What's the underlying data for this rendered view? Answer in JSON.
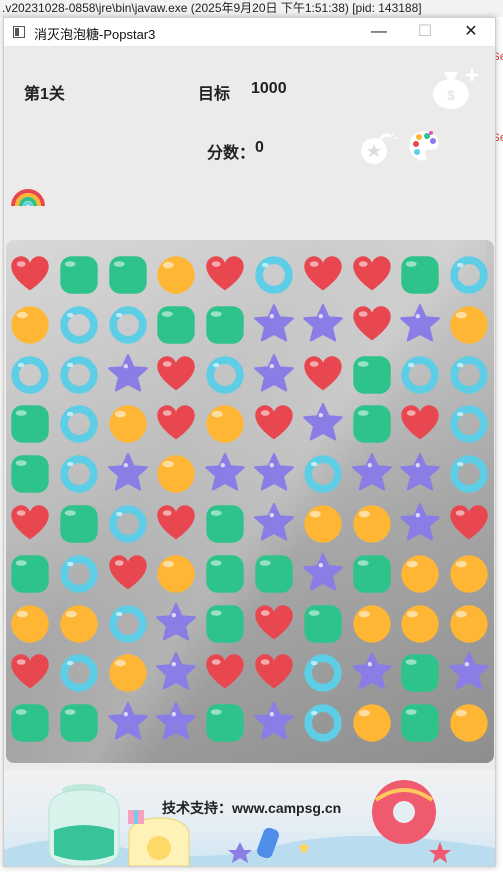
{
  "console": {
    "path_text": ".v20231028-0858\\jre\\bin\\javaw.exe  (2025年9月20日 下午1:51:38) [pid: 143188]",
    "right_fragments": [
      "Se",
      "Se"
    ]
  },
  "window": {
    "title": "消灭泡泡糖-Popstar3",
    "minimize": "—",
    "maximize": "☐",
    "close": "✕"
  },
  "hud": {
    "level": "第1关",
    "target_label": "目标",
    "target_value": "1000",
    "score_label": "分数：",
    "score_value": "0"
  },
  "icons": {
    "money_bag": "money-bag-icon",
    "bomb": "bomb-icon",
    "palette": "palette-icon",
    "rainbow": "rainbow-icon"
  },
  "colors": {
    "heart": "#e8474f",
    "square": "#2fc38c",
    "circle": "#ffb634",
    "ring": "#5ecde6",
    "star": "#8a7de6"
  },
  "board": {
    "rows": [
      [
        "heart",
        "square",
        "square",
        "circle",
        "heart",
        "ring",
        "heart",
        "heart",
        "square",
        "ring"
      ],
      [
        "circle",
        "ring",
        "ring",
        "square",
        "square",
        "star",
        "star",
        "heart",
        "star",
        "circle"
      ],
      [
        "ring",
        "ring",
        "star",
        "heart",
        "ring",
        "star",
        "heart",
        "square",
        "ring",
        "ring"
      ],
      [
        "square",
        "ring",
        "circle",
        "heart",
        "circle",
        "heart",
        "star",
        "square",
        "heart",
        "ring"
      ],
      [
        "square",
        "ring",
        "star",
        "circle",
        "star",
        "star",
        "ring",
        "star",
        "star",
        "ring"
      ],
      [
        "heart",
        "square",
        "ring",
        "heart",
        "square",
        "star",
        "circle",
        "circle",
        "star",
        "heart"
      ],
      [
        "square",
        "ring",
        "heart",
        "circle",
        "square",
        "square",
        "star",
        "square",
        "circle",
        "circle"
      ],
      [
        "circle",
        "circle",
        "ring",
        "star",
        "square",
        "heart",
        "square",
        "circle",
        "circle",
        "circle"
      ],
      [
        "heart",
        "ring",
        "circle",
        "star",
        "heart",
        "heart",
        "ring",
        "star",
        "square",
        "star"
      ],
      [
        "square",
        "square",
        "star",
        "star",
        "square",
        "star",
        "ring",
        "circle",
        "square",
        "circle"
      ]
    ]
  },
  "footer": {
    "credit": "技术支持：www.campsg.cn"
  }
}
